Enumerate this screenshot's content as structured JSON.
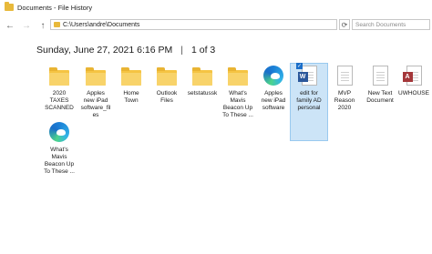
{
  "window": {
    "title": "Documents - File History"
  },
  "nav": {
    "back_glyph": "←",
    "forward_glyph": "→",
    "up_glyph": "↑",
    "address": "C:\\Users\\andre\\Documents",
    "refresh_glyph": "⟳",
    "search_placeholder": "Search Documents"
  },
  "header": {
    "date": "Sunday, June 27, 2021 6:16 PM",
    "separator": "|",
    "page": "1 of 3"
  },
  "items": [
    {
      "label": "2020\nTAXES\nSCANNED",
      "icon": "folder-icon"
    },
    {
      "label": "Apples\nnew iPad\nsoftware_fil\nes",
      "icon": "folder-icon"
    },
    {
      "label": "Home\nTown",
      "icon": "folder-icon"
    },
    {
      "label": "Outlook\nFiles",
      "icon": "folder-icon"
    },
    {
      "label": "setstatussk",
      "icon": "folder-icon"
    },
    {
      "label": "What's\nMavis\nBeacon Up\nTo These ...",
      "icon": "folder-icon"
    },
    {
      "label": "Apples\nnew iPad\nsoftware",
      "icon": "edge-icon"
    },
    {
      "label": "edit for\nfamily AD\npersonal",
      "icon": "word-document-icon",
      "selected": true
    },
    {
      "label": "MVP\nReason\n2020",
      "icon": "text-document-icon"
    },
    {
      "label": "New Text\nDocument",
      "icon": "text-document-icon"
    },
    {
      "label": "UWHOUSE",
      "icon": "access-database-icon"
    },
    {
      "label": "What's\nMavis\nBeacon Up\nTo These ...",
      "icon": "edge-icon"
    }
  ]
}
